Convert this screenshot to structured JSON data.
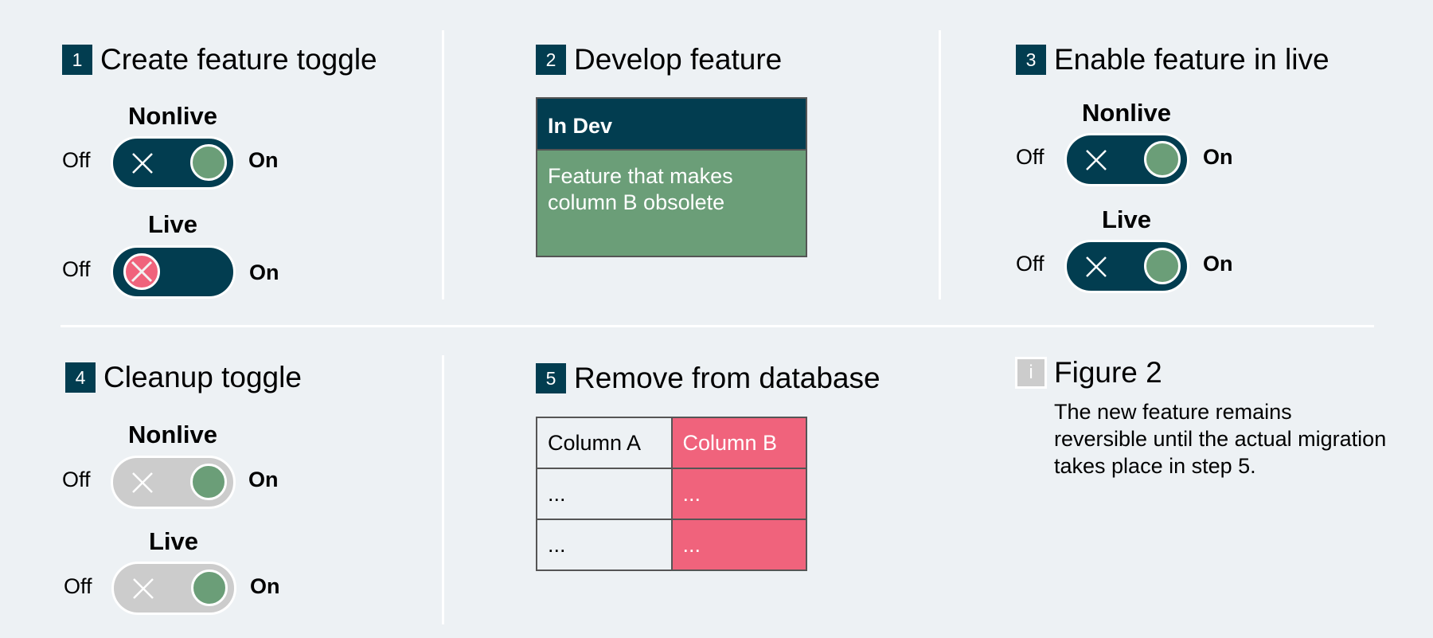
{
  "colors": {
    "background": "#edf1f4",
    "primary_dark": "#023d50",
    "active_green": "#6b9e78",
    "removed_pink": "#f0637c",
    "inactive_gray": "#cccccc",
    "divider": "#ffffff"
  },
  "steps": [
    {
      "number": "1",
      "title": "Create feature toggle",
      "toggles": [
        {
          "environment": "Nonlive",
          "off_label": "Off",
          "on_label": "On",
          "state": "on",
          "style": "active"
        },
        {
          "environment": "Live",
          "off_label": "Off",
          "on_label": "On",
          "state": "off",
          "style": "active"
        }
      ]
    },
    {
      "number": "2",
      "title": "Develop feature",
      "card": {
        "header": "In Dev",
        "body": "Feature that makes column B obsolete"
      }
    },
    {
      "number": "3",
      "title": "Enable feature in live",
      "toggles": [
        {
          "environment": "Nonlive",
          "off_label": "Off",
          "on_label": "On",
          "state": "on",
          "style": "active"
        },
        {
          "environment": "Live",
          "off_label": "Off",
          "on_label": "On",
          "state": "on",
          "style": "active"
        }
      ]
    },
    {
      "number": "4",
      "title": "Cleanup toggle",
      "toggles": [
        {
          "environment": "Nonlive",
          "off_label": "Off",
          "on_label": "On",
          "state": "on",
          "style": "disabled"
        },
        {
          "environment": "Live",
          "off_label": "Off",
          "on_label": "On",
          "state": "on",
          "style": "disabled"
        }
      ]
    },
    {
      "number": "5",
      "title": "Remove from database",
      "table": {
        "columns": [
          "Column A",
          "Column B"
        ],
        "rows": [
          [
            "...",
            "..."
          ],
          [
            "...",
            "..."
          ]
        ],
        "removed_column": "Column B"
      }
    }
  ],
  "figure": {
    "icon": "info-icon",
    "icon_glyph": "i",
    "title": "Figure 2",
    "caption": "The new feature remains reversible until the actual migration takes place in step 5."
  },
  "icons": {
    "toggle_off_mark": "close-x-icon"
  }
}
